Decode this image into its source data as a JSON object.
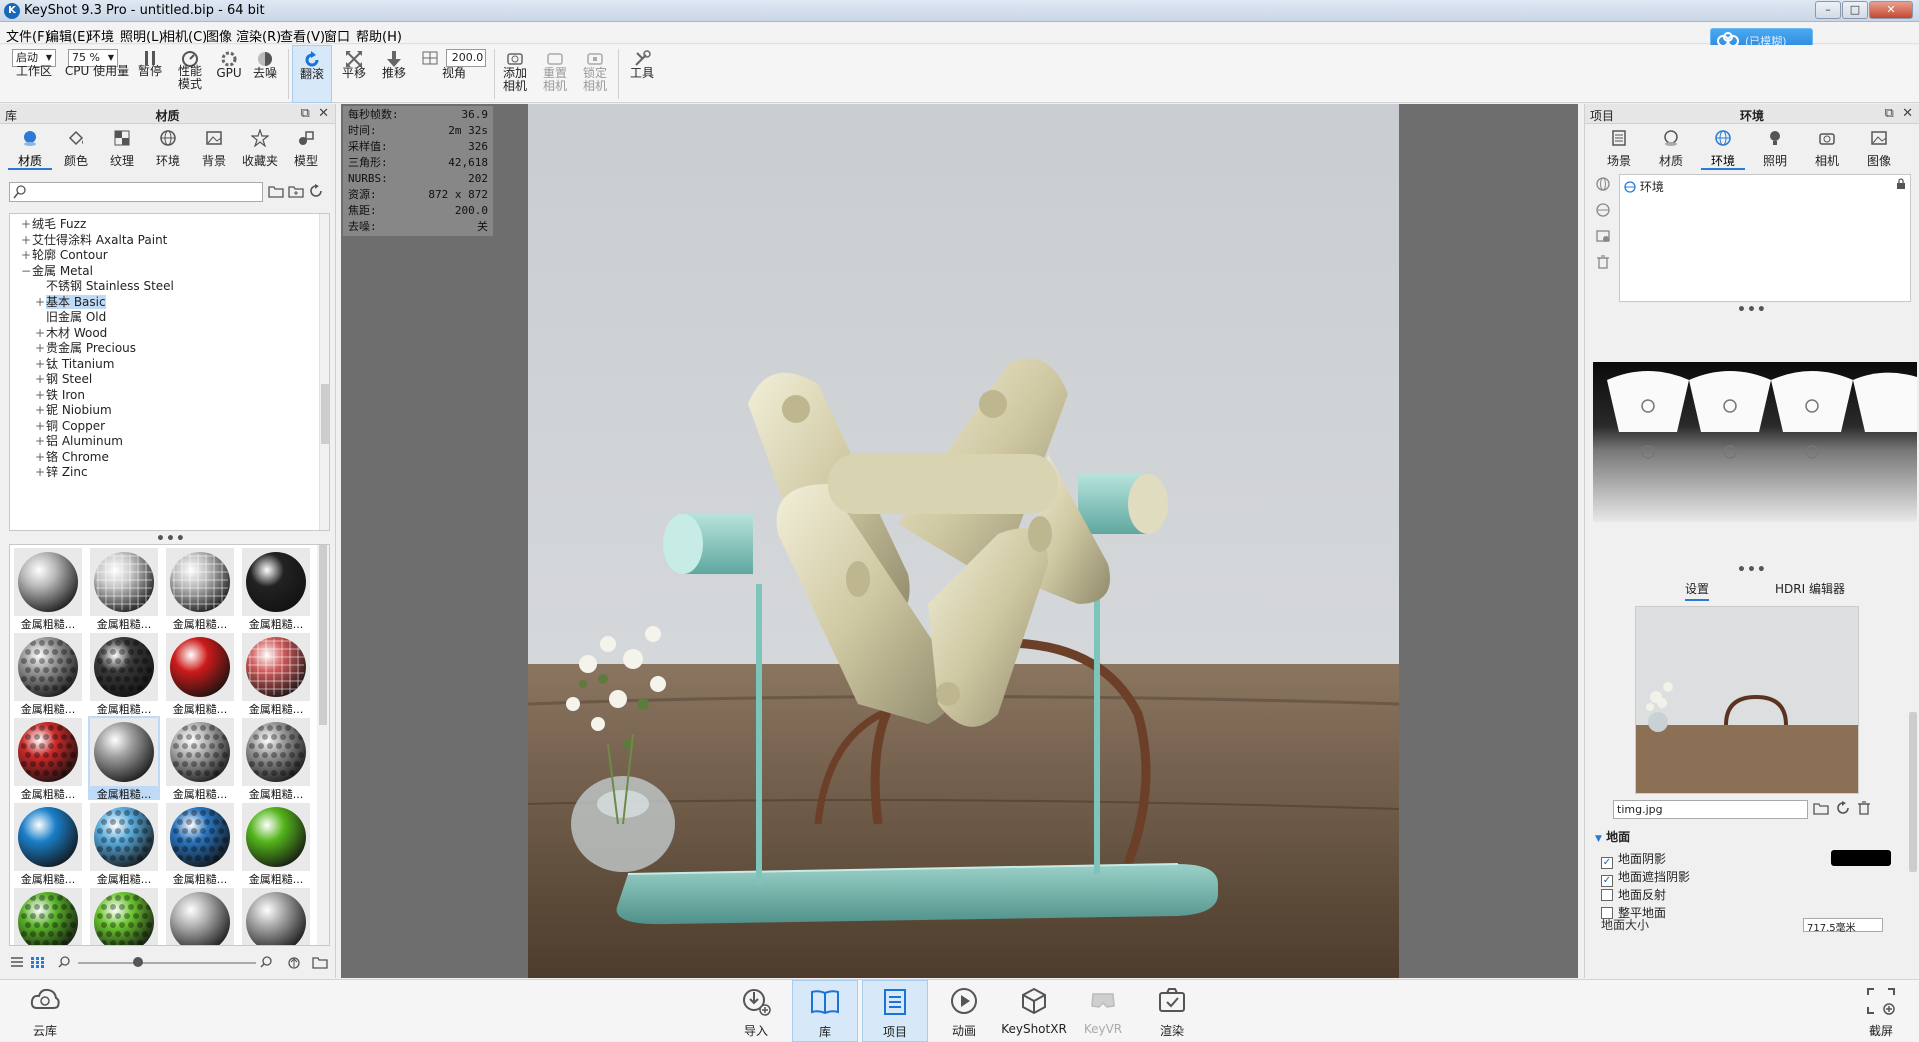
{
  "window": {
    "title": "KeyShot 9.3 Pro  - untitled.bip  - 64 bit",
    "minimize": "–",
    "maximize": "□",
    "close": "✕"
  },
  "menu": [
    "文件(F)",
    "编辑(E)",
    "环境",
    "照明(L)",
    "相机(C)",
    "图像",
    "渲染(R)",
    "查看(V)",
    "窗口",
    "帮助(H)"
  ],
  "cloud_badge": "(已模糊)",
  "toolbar": {
    "workspace_select": "启动",
    "workspace_label": "工作区",
    "cpu_select": "75 %",
    "cpu_label": "CPU 使用量",
    "pause": "暂停",
    "perf_mode": "性能\n模式",
    "gpu": "GPU",
    "denoise": "去噪",
    "tumble": "翻滚",
    "pan": "平移",
    "dolly": "推移",
    "fov_value": "200.0",
    "fov_label": "视角",
    "add_camera": "添加\n相机",
    "reset_camera": "重置\n相机",
    "lock_camera": "锁定\n相机",
    "tools": "工具"
  },
  "library": {
    "header_left": "库",
    "header_title": "材质",
    "tabs": [
      "材质",
      "颜色",
      "纹理",
      "环境",
      "背景",
      "收藏夹",
      "模型"
    ],
    "search_placeholder": "",
    "tree": [
      {
        "pm": "+",
        "text": "绒毛 Fuzz",
        "indent": 1
      },
      {
        "pm": "+",
        "text": "艾仕得涂料 Axalta Paint",
        "indent": 1
      },
      {
        "pm": "+",
        "text": "轮廓 Contour",
        "indent": 1
      },
      {
        "pm": "−",
        "text": "金属 Metal",
        "indent": 1
      },
      {
        "pm": "",
        "text": "不锈钢 Stainless Steel",
        "indent": 2
      },
      {
        "pm": "+",
        "text": "基本 Basic",
        "indent": 2,
        "selected": true
      },
      {
        "pm": "",
        "text": "旧金属 Old",
        "indent": 2
      },
      {
        "pm": "+",
        "text": "木材 Wood",
        "indent": 2
      },
      {
        "pm": "+",
        "text": "贵金属 Precious",
        "indent": 2
      },
      {
        "pm": "+",
        "text": "钛 Titanium",
        "indent": 2
      },
      {
        "pm": "+",
        "text": "钢 Steel",
        "indent": 2
      },
      {
        "pm": "+",
        "text": "铁 Iron",
        "indent": 2
      },
      {
        "pm": "+",
        "text": "铌 Niobium",
        "indent": 2
      },
      {
        "pm": "+",
        "text": "铜 Copper",
        "indent": 2
      },
      {
        "pm": "+",
        "text": "铝 Aluminum",
        "indent": 2
      },
      {
        "pm": "+",
        "text": "铬 Chrome",
        "indent": 2
      },
      {
        "pm": "+",
        "text": "锌 Zinc",
        "indent": 2
      }
    ],
    "thumb_label": "金属粗糙...",
    "thumbs": [
      {
        "color": "#b8b8b8",
        "style": "smooth"
      },
      {
        "color": "#c8c8c8",
        "style": "mesh"
      },
      {
        "color": "#bdbdbd",
        "style": "mesh"
      },
      {
        "color": "#222222",
        "style": "smooth"
      },
      {
        "color": "#9a9a9a",
        "style": "hex"
      },
      {
        "color": "#3a3a3a",
        "style": "hex"
      },
      {
        "color": "#cc1b1b",
        "style": "smooth"
      },
      {
        "color": "#d05a5a",
        "style": "mesh"
      },
      {
        "color": "#cc2a2a",
        "style": "hex"
      },
      {
        "color": "#a0a0a0",
        "style": "smooth"
      },
      {
        "color": "#b0b0b0",
        "style": "hex"
      },
      {
        "color": "#9a9a9a",
        "style": "hex"
      },
      {
        "color": "#1b7fc9",
        "style": "smooth"
      },
      {
        "color": "#5aaee0",
        "style": "hex"
      },
      {
        "color": "#2a76c0",
        "style": "hex"
      },
      {
        "color": "#55b51c",
        "style": "smooth"
      },
      {
        "color": "#5ab52a",
        "style": "hex"
      },
      {
        "color": "#6cc830",
        "style": "hex"
      },
      {
        "color": "#b0b0b0",
        "style": "smooth"
      },
      {
        "color": "#a8a8a8",
        "style": "smooth"
      }
    ],
    "selected_thumb": 9
  },
  "stats": [
    {
      "k": "每秒帧数:",
      "v": "36.9"
    },
    {
      "k": "时间:",
      "v": "2m 32s"
    },
    {
      "k": "采样值:",
      "v": "326"
    },
    {
      "k": "三角形:",
      "v": "42,618"
    },
    {
      "k": "NURBS:",
      "v": "202"
    },
    {
      "k": "资源:",
      "v": "872 x 872"
    },
    {
      "k": "焦距:",
      "v": "200.0"
    },
    {
      "k": "去噪:",
      "v": "关"
    }
  ],
  "project": {
    "header_left": "项目",
    "header_title": "环境",
    "tabs": [
      "场景",
      "材质",
      "环境",
      "照明",
      "相机",
      "图像"
    ],
    "env_item": "环境",
    "subtabs": [
      "设置",
      "HDRI 编辑器"
    ],
    "bg_file": "timg.jpg",
    "ground_header": "地面",
    "ground_options": [
      {
        "label": "地面阴影",
        "checked": true
      },
      {
        "label": "地面遮挡阴影",
        "checked": true
      },
      {
        "label": "地面反射",
        "checked": false
      },
      {
        "label": "整平地面",
        "checked": false
      }
    ],
    "ground_size_label": "地面大小",
    "ground_size_value": "717.5毫米"
  },
  "bottom": [
    "云库",
    "导入",
    "库",
    "项目",
    "动画",
    "KeyShotXR",
    "KeyVR",
    "渲染",
    "截屏"
  ],
  "colors": {
    "accent": "#2b7bd6",
    "panel": "#f0f0f0",
    "viewport": "#6e6e6e",
    "selection": "#bfdaf6"
  }
}
